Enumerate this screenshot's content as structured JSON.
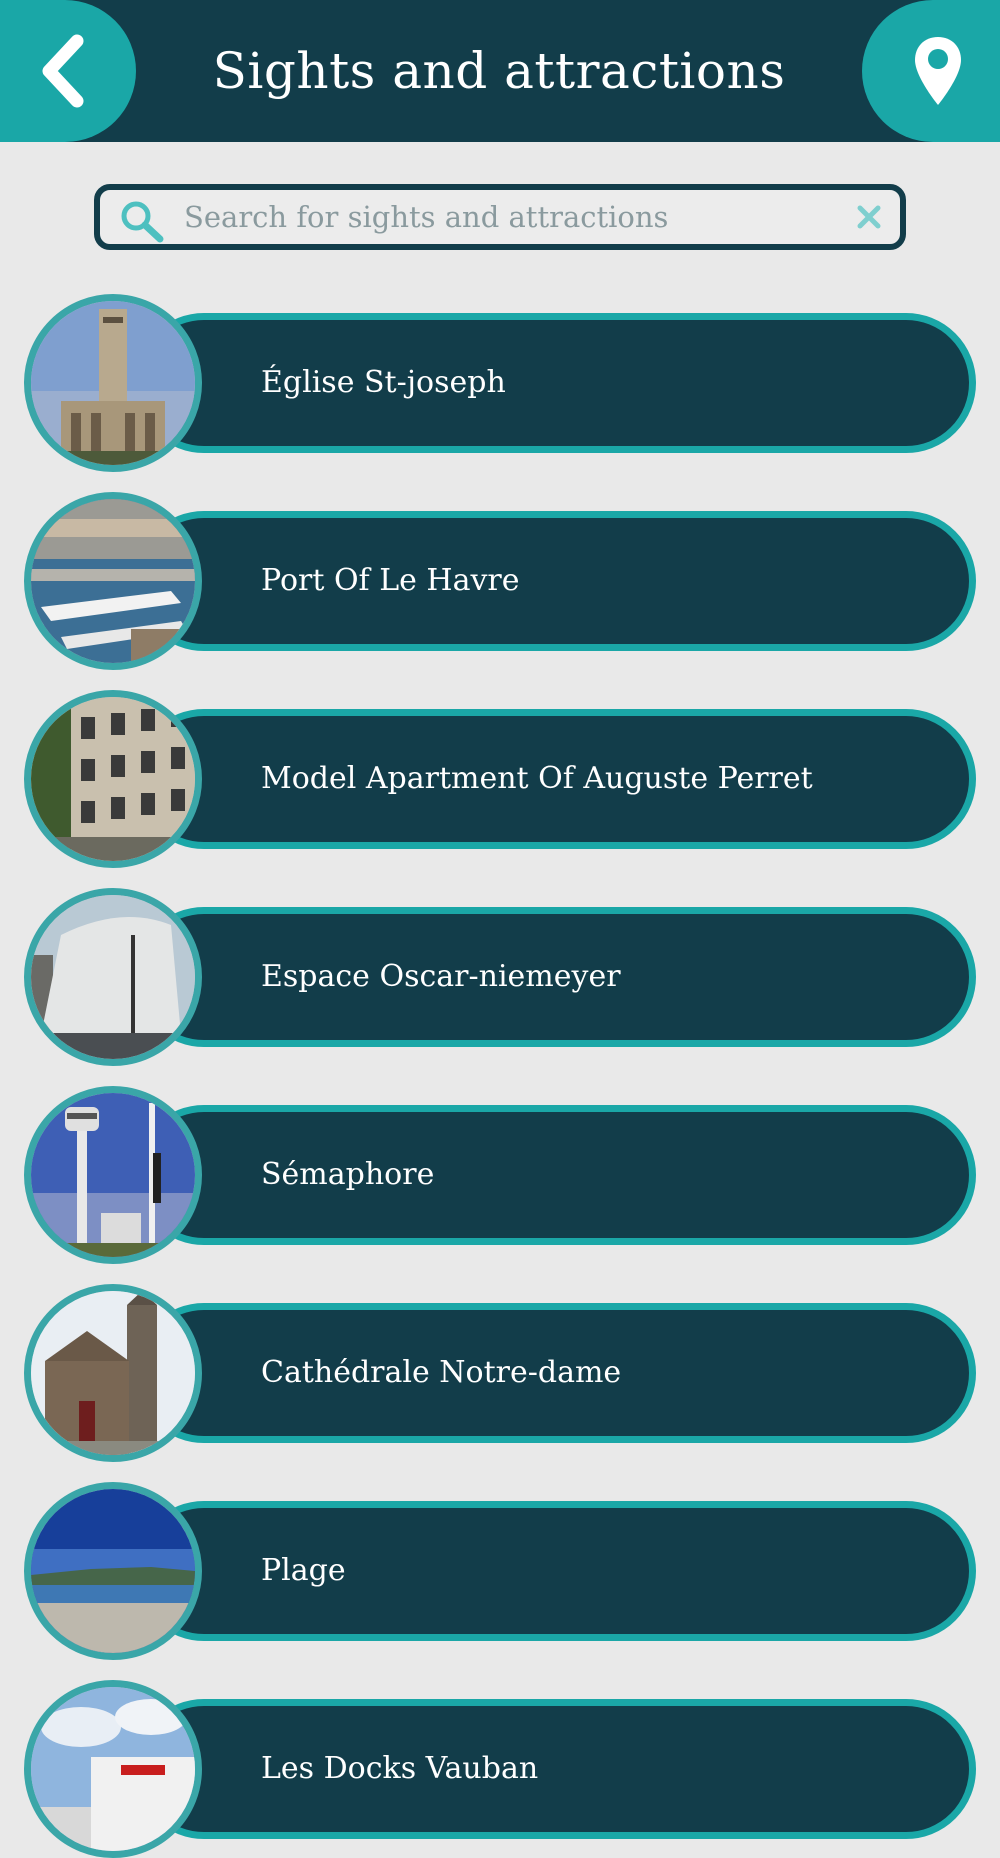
{
  "header": {
    "title": "Sights and attractions",
    "back_icon": "chevron-left-icon",
    "location_icon": "map-pin-icon"
  },
  "search": {
    "placeholder": "Search for sights and attractions",
    "value": "",
    "search_icon": "search-icon",
    "clear_icon": "close-icon"
  },
  "colors": {
    "header_bg": "#123d4a",
    "accent": "#1aa7a7",
    "page_bg": "#e9e9e9"
  },
  "attractions": [
    {
      "name": "Église St-joseph",
      "image": "church-tower-photo"
    },
    {
      "name": "Port Of Le Havre",
      "image": "port-aerial-photo"
    },
    {
      "name": "Model Apartment Of Auguste Perret",
      "image": "apartment-building-photo"
    },
    {
      "name": "Espace Oscar-niemeyer",
      "image": "volcano-building-photo"
    },
    {
      "name": "Sémaphore",
      "image": "semaphore-tower-photo"
    },
    {
      "name": "Cathédrale Notre-dame",
      "image": "cathedral-photo"
    },
    {
      "name": "Plage",
      "image": "beach-photo"
    },
    {
      "name": "Les Docks Vauban",
      "image": "docks-building-photo"
    }
  ]
}
